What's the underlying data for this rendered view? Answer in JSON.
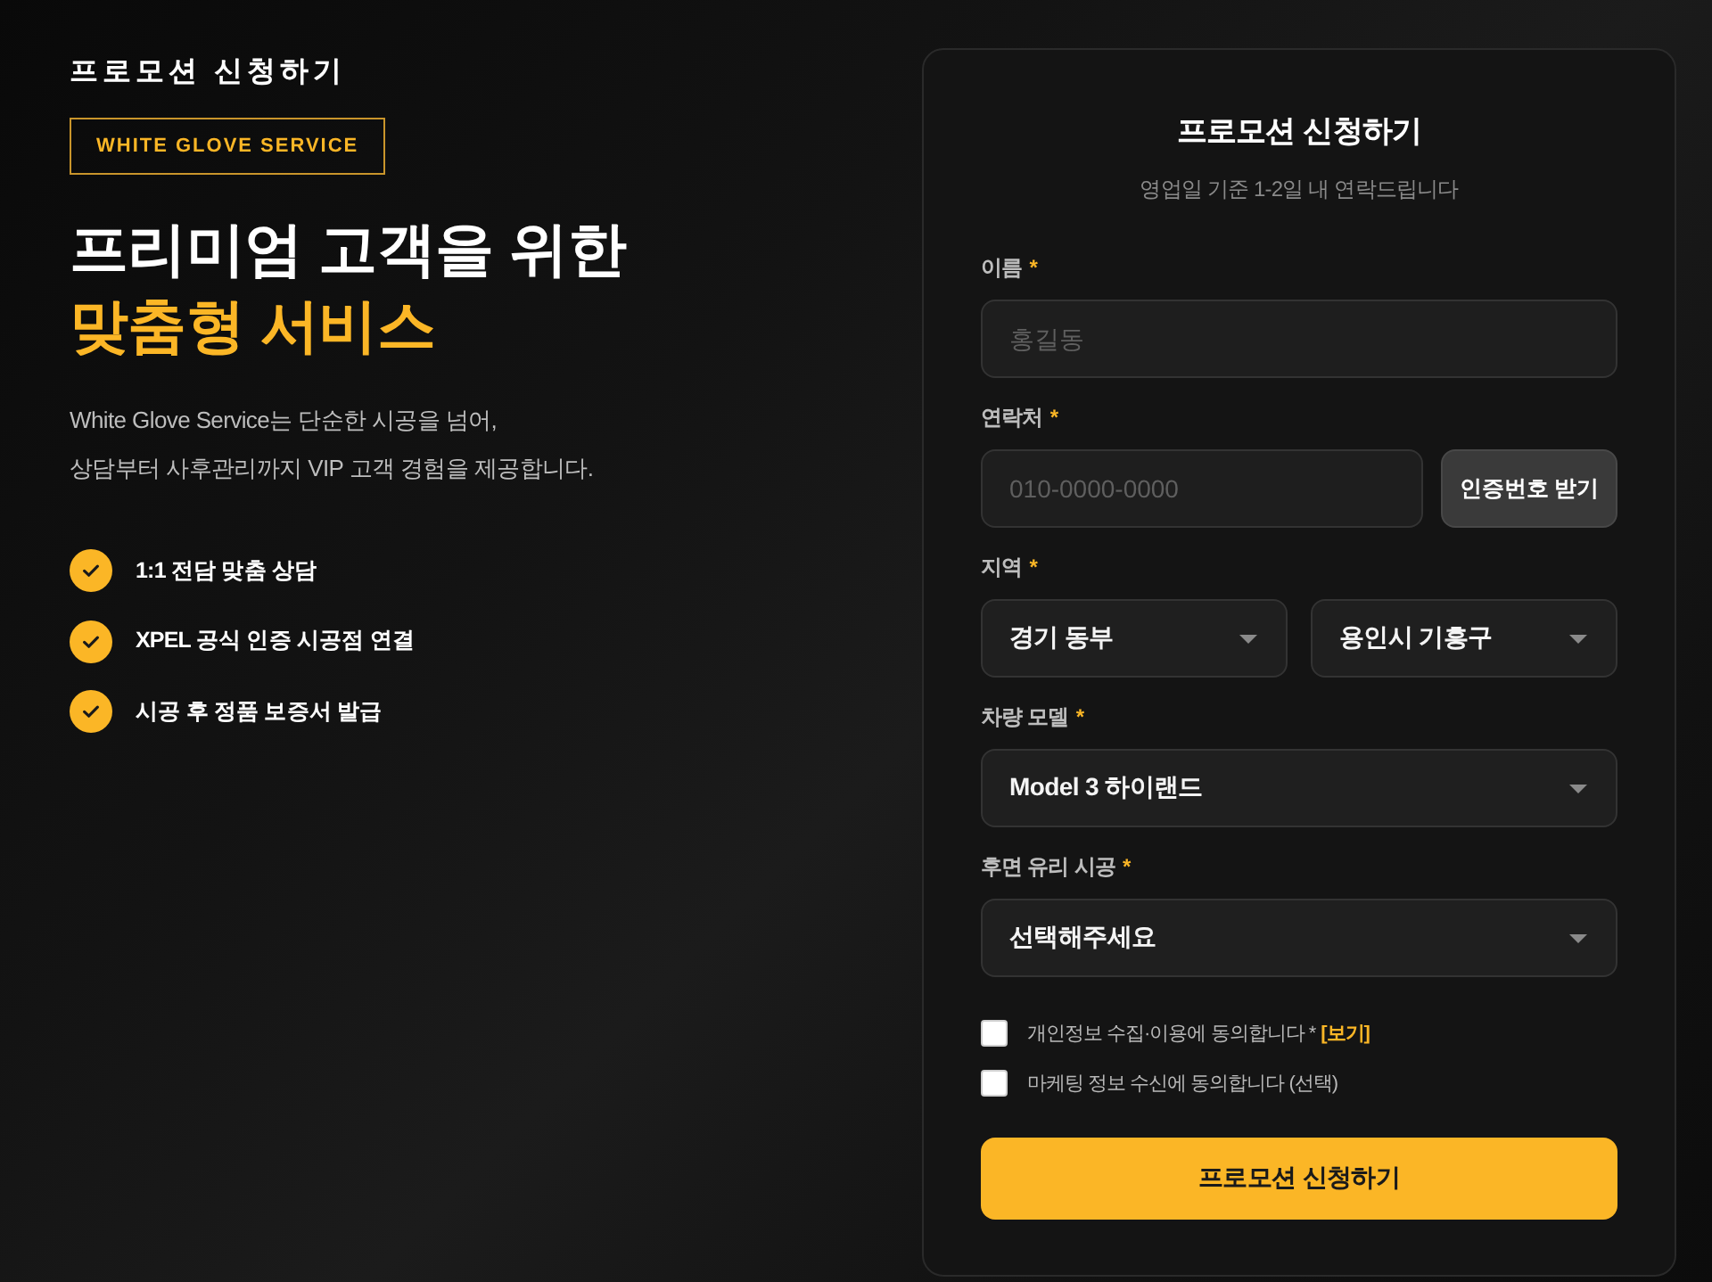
{
  "hero": {
    "eyebrow": "프로모션 신청하기",
    "badge": "WHITE GLOVE SERVICE",
    "headline": [
      {
        "text": "프리미엄 고객을 위한",
        "kind": "plain"
      },
      {
        "text": "맞춤형 서비스",
        "kind": "accent"
      }
    ],
    "description": [
      "White Glove Service는 단순한 시공을 넘어,",
      "상담부터 사후관리까지 VIP 고객 경험을 제공합니다."
    ],
    "features": [
      "1:1 전담 맞춤 상담",
      "XPEL 공식 인증 시공점 연결",
      "시공 후 정품 보증서 발급"
    ]
  },
  "form": {
    "title": "프로모션 신청하기",
    "subtitle": "영업일 기준 1-2일 내 연락드립니다",
    "fields": [
      {
        "kind": "text",
        "label": "이름",
        "required_mark": "*",
        "placeholder": "홍길동"
      },
      {
        "kind": "text_with_button",
        "label": "연락처",
        "required_mark": "*",
        "placeholder": "010-0000-0000",
        "button": "인증번호 받기"
      },
      {
        "kind": "select_pair",
        "label": "지역",
        "required_mark": "*",
        "values": [
          "경기 동부",
          "용인시 기흥구"
        ]
      },
      {
        "kind": "select",
        "label": "차량 모델",
        "required_mark": "*",
        "value": "Model 3 하이랜드"
      },
      {
        "kind": "select",
        "label": "후면 유리 시공",
        "required_mark": "*",
        "value": "선택해주세요"
      }
    ],
    "consents": [
      {
        "text": "개인정보 수집·이용에 동의합니다 *",
        "link": "[보기]",
        "checked": false
      },
      {
        "text": "마케팅 정보 수신에 동의합니다 (선택)",
        "checked": false
      }
    ],
    "submit": "프로모션 신청하기"
  }
}
